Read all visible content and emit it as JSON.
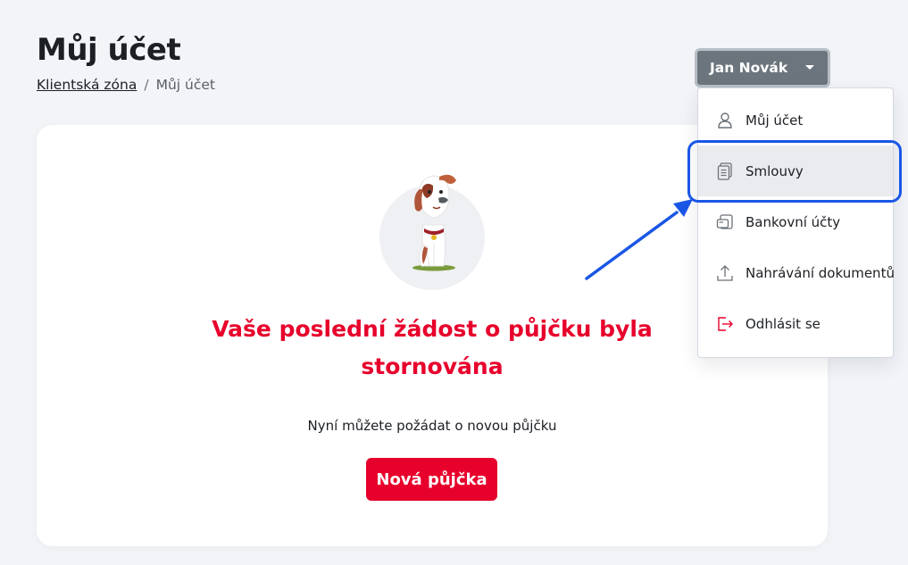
{
  "header": {
    "title": "Můj účet",
    "breadcrumb": {
      "link_label": "Klientská zóna",
      "separator": "/",
      "current": "Můj účet"
    }
  },
  "user_menu": {
    "toggle_label": "Jan Novák",
    "items": [
      {
        "label": "Můj účet",
        "icon": "user-icon"
      },
      {
        "label": "Smlouvy",
        "icon": "document-icon",
        "highlighted": true
      },
      {
        "label": "Bankovní účty",
        "icon": "bank-card-icon"
      },
      {
        "label": "Nahrávání dokumentů",
        "icon": "upload-icon"
      },
      {
        "label": "Odhlásit se",
        "icon": "logout-icon"
      }
    ]
  },
  "main": {
    "illustration": "dog-illustration",
    "headline": "Vaše poslední žádost o půjčku byla stornována",
    "subtext": "Nyní můžete požádat o novou půjčku",
    "button_label": "Nová půjčka"
  },
  "colors": {
    "brand_red": "#e7002b",
    "annotation_blue": "#1a56e6",
    "toggle_gray": "#6c757d",
    "page_bg": "#f2f4f8"
  }
}
